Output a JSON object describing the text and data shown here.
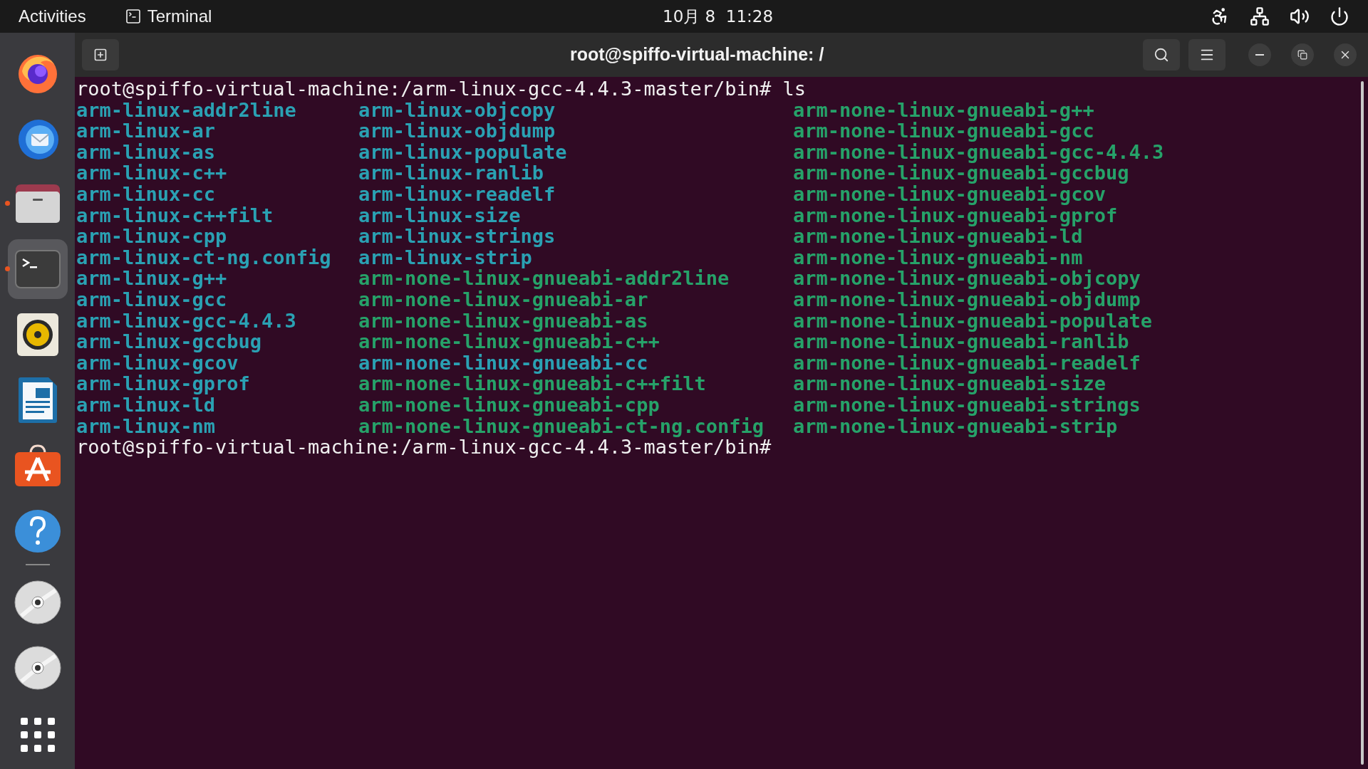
{
  "top_bar": {
    "activities": "Activities",
    "app_name": "Terminal",
    "clock": "10月 8  11:28"
  },
  "dock": {
    "items": [
      {
        "kind": "browser",
        "running": false
      },
      {
        "kind": "mail",
        "running": false
      },
      {
        "kind": "files",
        "running": true
      },
      {
        "kind": "terminal",
        "running": true,
        "selected": true
      },
      {
        "kind": "music",
        "running": false
      },
      {
        "kind": "writer",
        "running": false
      },
      {
        "kind": "store",
        "running": false
      },
      {
        "kind": "help",
        "running": false
      },
      {
        "kind": "disc",
        "running": false
      },
      {
        "kind": "disc",
        "running": false
      }
    ]
  },
  "window": {
    "title": "root@spiffo-virtual-machine: /"
  },
  "terminal": {
    "command_line": {
      "prompt": "root@spiffo-virtual-machine:/arm-linux-gcc-4.4.3-master/bin#",
      "command": "ls"
    },
    "listing": [
      {
        "entries": [
          {
            "name": "arm-linux-addr2line",
            "color": "#2aa1b3"
          },
          {
            "name": "arm-linux-ar",
            "color": "#2aa1b3"
          },
          {
            "name": "arm-linux-as",
            "color": "#2aa1b3"
          },
          {
            "name": "arm-linux-c++",
            "color": "#2aa1b3"
          },
          {
            "name": "arm-linux-cc",
            "color": "#2aa1b3"
          },
          {
            "name": "arm-linux-c++filt",
            "color": "#2aa1b3"
          },
          {
            "name": "arm-linux-cpp",
            "color": "#2aa1b3"
          },
          {
            "name": "arm-linux-ct-ng.config",
            "color": "#2aa1b3"
          },
          {
            "name": "arm-linux-g++",
            "color": "#2aa1b3"
          },
          {
            "name": "arm-linux-gcc",
            "color": "#2aa1b3"
          },
          {
            "name": "arm-linux-gcc-4.4.3",
            "color": "#2aa1b3"
          },
          {
            "name": "arm-linux-gccbug",
            "color": "#2aa1b3"
          },
          {
            "name": "arm-linux-gcov",
            "color": "#2aa1b3"
          },
          {
            "name": "arm-linux-gprof",
            "color": "#2aa1b3"
          },
          {
            "name": "arm-linux-ld",
            "color": "#2aa1b3"
          },
          {
            "name": "arm-linux-nm",
            "color": "#2aa1b3"
          }
        ]
      },
      {
        "entries": [
          {
            "name": "arm-linux-objcopy",
            "color": "#2aa1b3"
          },
          {
            "name": "arm-linux-objdump",
            "color": "#2aa1b3"
          },
          {
            "name": "arm-linux-populate",
            "color": "#2aa1b3"
          },
          {
            "name": "arm-linux-ranlib",
            "color": "#2aa1b3"
          },
          {
            "name": "arm-linux-readelf",
            "color": "#2aa1b3"
          },
          {
            "name": "arm-linux-size",
            "color": "#2aa1b3"
          },
          {
            "name": "arm-linux-strings",
            "color": "#2aa1b3"
          },
          {
            "name": "arm-linux-strip",
            "color": "#2aa1b3"
          },
          {
            "name": "arm-none-linux-gnueabi-addr2line",
            "color": "#26a269"
          },
          {
            "name": "arm-none-linux-gnueabi-ar",
            "color": "#26a269"
          },
          {
            "name": "arm-none-linux-gnueabi-as",
            "color": "#26a269"
          },
          {
            "name": "arm-none-linux-gnueabi-c++",
            "color": "#26a269"
          },
          {
            "name": "arm-none-linux-gnueabi-cc",
            "color": "#2aa1b3"
          },
          {
            "name": "arm-none-linux-gnueabi-c++filt",
            "color": "#26a269"
          },
          {
            "name": "arm-none-linux-gnueabi-cpp",
            "color": "#26a269"
          },
          {
            "name": "arm-none-linux-gnueabi-ct-ng.config",
            "color": "#26a269"
          }
        ]
      },
      {
        "entries": [
          {
            "name": "arm-none-linux-gnueabi-g++",
            "color": "#26a269"
          },
          {
            "name": "arm-none-linux-gnueabi-gcc",
            "color": "#26a269"
          },
          {
            "name": "arm-none-linux-gnueabi-gcc-4.4.3",
            "color": "#26a269"
          },
          {
            "name": "arm-none-linux-gnueabi-gccbug",
            "color": "#26a269"
          },
          {
            "name": "arm-none-linux-gnueabi-gcov",
            "color": "#26a269"
          },
          {
            "name": "arm-none-linux-gnueabi-gprof",
            "color": "#26a269"
          },
          {
            "name": "arm-none-linux-gnueabi-ld",
            "color": "#26a269"
          },
          {
            "name": "arm-none-linux-gnueabi-nm",
            "color": "#26a269"
          },
          {
            "name": "arm-none-linux-gnueabi-objcopy",
            "color": "#26a269"
          },
          {
            "name": "arm-none-linux-gnueabi-objdump",
            "color": "#26a269"
          },
          {
            "name": "arm-none-linux-gnueabi-populate",
            "color": "#26a269"
          },
          {
            "name": "arm-none-linux-gnueabi-ranlib",
            "color": "#26a269"
          },
          {
            "name": "arm-none-linux-gnueabi-readelf",
            "color": "#26a269"
          },
          {
            "name": "arm-none-linux-gnueabi-size",
            "color": "#26a269"
          },
          {
            "name": "arm-none-linux-gnueabi-strings",
            "color": "#26a269"
          },
          {
            "name": "arm-none-linux-gnueabi-strip",
            "color": "#26a269"
          }
        ]
      }
    ],
    "final_prompt": "root@spiffo-virtual-machine:/arm-linux-gcc-4.4.3-master/bin#"
  }
}
